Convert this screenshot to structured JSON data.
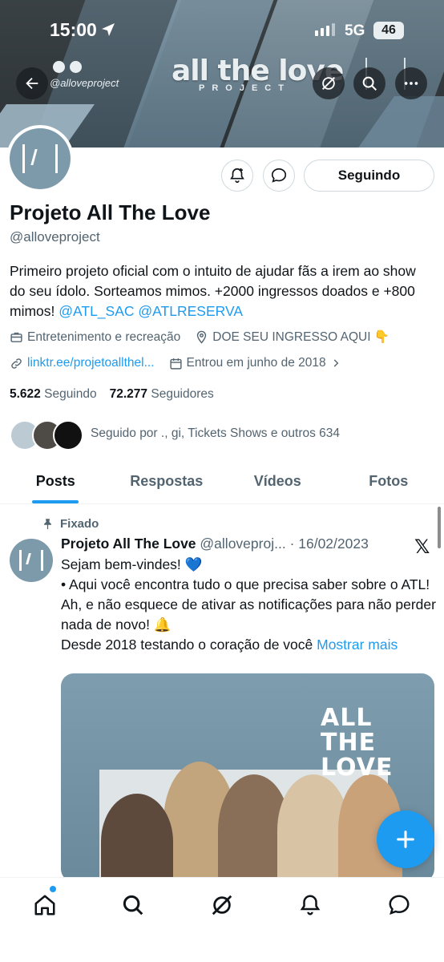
{
  "status_bar": {
    "time": "15:00",
    "network": "5G",
    "battery": "46"
  },
  "banner": {
    "title": "all the love",
    "subtitle": "PROJECT",
    "handle": "@alloveproject"
  },
  "actions": {
    "following_label": "Seguindo"
  },
  "profile": {
    "name": "Projeto All The Love",
    "handle": "@alloveproject",
    "bio_text": "Primeiro projeto oficial com o intuito de ajudar fãs a irem ao show do seu ídolo. Sorteamos mimos. +2000 ingressos doados e +800 mimos! ",
    "bio_mention_1": "@ATL_SAC",
    "bio_mention_2": "@ATLRESERVA",
    "category": "Entretenimento e recreação",
    "location": "DOE SEU INGRESSO AQUI 👇",
    "website": "linktr.ee/projetoallthel...",
    "joined": "Entrou em junho de 2018",
    "following_count": "5.622",
    "following_label": "Seguindo",
    "followers_count": "72.277",
    "followers_label": "Seguidores",
    "followed_by": "Seguido por ., gi, Tickets Shows e outros 634"
  },
  "tabs": [
    {
      "label": "Posts",
      "active": true
    },
    {
      "label": "Respostas",
      "active": false
    },
    {
      "label": "Vídeos",
      "active": false
    },
    {
      "label": "Fotos",
      "active": false
    }
  ],
  "post": {
    "pinned_label": "Fixado",
    "author": "Projeto All The Love",
    "handle": "@alloveproj...",
    "date": "· 16/02/2023",
    "line1": "Sejam bem-vindes! 💙",
    "line2": "•  Aqui você encontra tudo o que precisa saber sobre o ATL!",
    "line3": "Ah, e não esquece de ativar as notificações para não perder nada de novo!  🔔",
    "line4": "Desde 2018 testando o coração de você ",
    "show_more": "Mostrar mais",
    "image_headline": "ALL\nTHE\nLOVE"
  },
  "colors": {
    "accent": "#1d9bf0",
    "text": "#0f1419",
    "muted": "#536471"
  },
  "icons": [
    "back-arrow-icon",
    "grok-icon",
    "search-icon",
    "more-icon",
    "bell-plus-icon",
    "message-icon",
    "briefcase-icon",
    "location-pin-icon",
    "link-icon",
    "calendar-icon",
    "pin-icon",
    "x-logo-icon",
    "plus-icon",
    "home-icon",
    "notifications-icon"
  ]
}
